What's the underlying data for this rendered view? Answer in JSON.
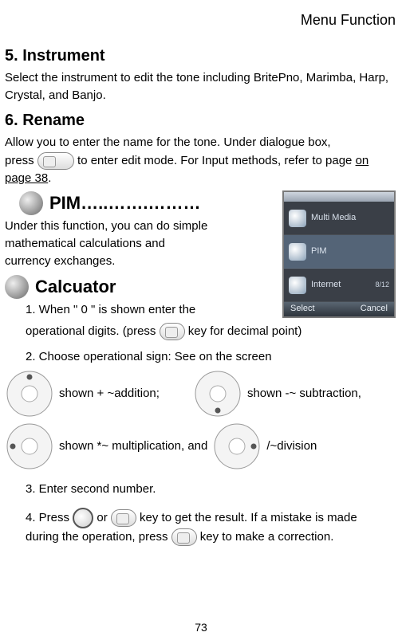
{
  "header": {
    "section": "Menu Function"
  },
  "s5": {
    "title": "5. Instrument",
    "body": "Select the instrument to edit the tone including BritePno, Marimba, Harp, Crystal, and Banjo."
  },
  "s6": {
    "title": "6. Rename",
    "line1": "Allow you to enter the name for the tone.    Under dialogue box,",
    "line2a": "press ",
    "line2b": " to enter edit mode.    For Input methods, refer to page ",
    "link": "on page 38",
    "line2c": "."
  },
  "pim": {
    "title": "PIM…..…….………",
    "body": "Under this function, you can do simple mathematical calculations and currency exchanges."
  },
  "screenshot": {
    "rows": [
      {
        "label": "Multi Media"
      },
      {
        "label": "PIM"
      },
      {
        "label": "Internet",
        "count": "8/12"
      }
    ],
    "soft_left": "Select",
    "soft_right": "Cancel"
  },
  "calc": {
    "title": "Calcuator",
    "s1a": "1. When \" 0 \" is shown enter the",
    "s1b": "operational digits. (press ",
    "s1c": " key for decimal point)",
    "s2": "2. Choose operational sign: See on the screen",
    "op_add": " shown + ~addition;",
    "op_sub": " shown -~ subtraction,",
    "op_mul": " shown *~ multiplication, and ",
    "op_div": " /~division",
    "s3": "3. Enter second number.",
    "s4a": "4. Press ",
    "s4b": " or ",
    "s4c": " key to get the result. If a mistake is made during the operation, press ",
    "s4d": " key to make a correction."
  },
  "page": "73"
}
